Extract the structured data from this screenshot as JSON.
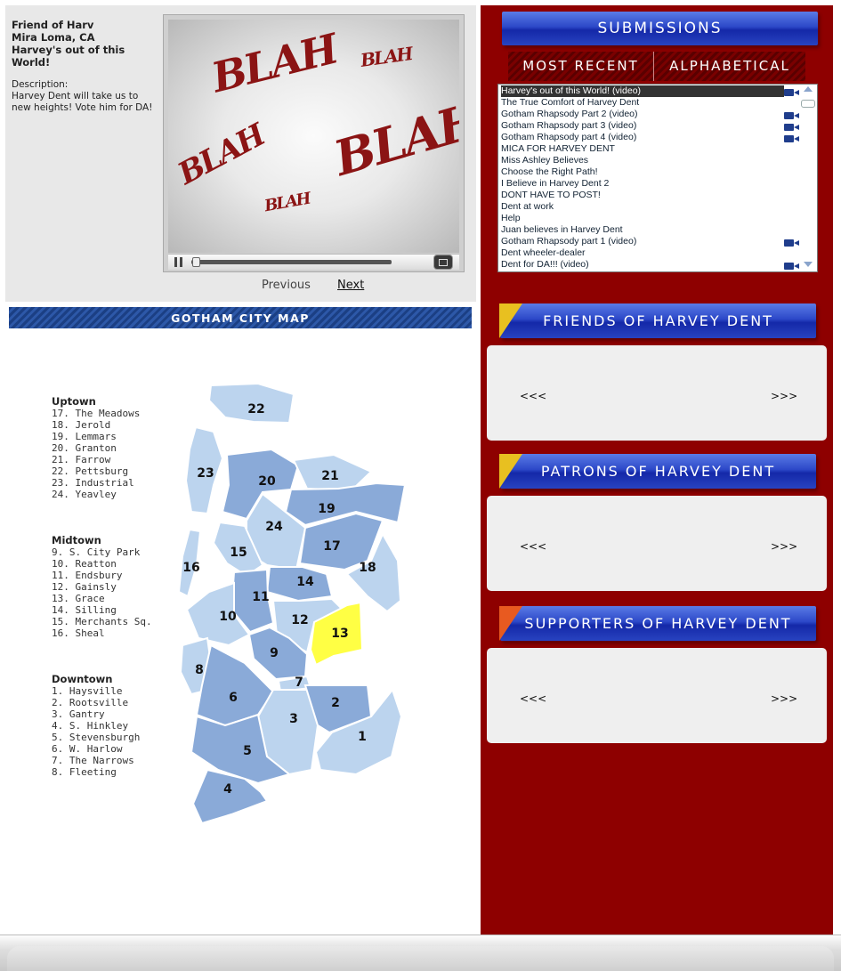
{
  "submission": {
    "author": "Friend of Harv",
    "location": "Mira Loma, CA",
    "title": "Harvey's out of this World!",
    "description_label": "Description:",
    "description": "Harvey Dent will take us to new heights! Vote him for DA!"
  },
  "video": {
    "overlay_words": [
      "BLAH",
      "BLAH",
      "BLAH",
      "BLAH",
      "BLAH",
      "BLAH"
    ],
    "progress": 0.0
  },
  "nav": {
    "previous": "Previous",
    "next": "Next"
  },
  "map": {
    "header": "GOTHAM CITY MAP",
    "highlighted_district": "13",
    "highlight_color": "#ffff44",
    "district_color": "#bcd4ee",
    "district_dark_color": "#8aaad8",
    "legend": [
      {
        "title": "Uptown",
        "items": [
          "17. The Meadows",
          "18. Jerold",
          "19. Lemmars",
          "20. Granton",
          "21. Farrow",
          "22. Pettsburg",
          "23. Industrial",
          "24. Yeavley"
        ]
      },
      {
        "title": "Midtown",
        "items": [
          "9. S. City Park",
          "10. Reatton",
          "11. Endsbury",
          "12. Gainsly",
          "13. Grace",
          "14. Silling",
          "15. Merchants Sq.",
          "16. Sheal"
        ]
      },
      {
        "title": "Downtown",
        "items": [
          "1. Haysville",
          "2. Rootsville",
          "3. Gantry",
          "4. S. Hinkley",
          "5. Stevensburgh",
          "6. W. Harlow",
          "7. The Narrows",
          "8. Fleeting"
        ]
      }
    ],
    "districts": [
      "22",
      "23",
      "20",
      "21",
      "19",
      "24",
      "17",
      "15",
      "16",
      "18",
      "14",
      "11",
      "10",
      "12",
      "13",
      "9",
      "8",
      "7",
      "6",
      "3",
      "2",
      "1",
      "5",
      "4"
    ]
  },
  "submissions": {
    "header": "SUBMISSIONS",
    "tabs": [
      "MOST RECENT",
      "ALPHABETICAL"
    ],
    "items": [
      {
        "label": "Harvey's out of this World! (video)",
        "video": true,
        "selected": true
      },
      {
        "label": "The True Comfort of Harvey Dent",
        "video": false,
        "selected": false
      },
      {
        "label": "Gotham Rhapsody Part 2 (video)",
        "video": true,
        "selected": false
      },
      {
        "label": "Gotham Rhapsody part 3 (video)",
        "video": true,
        "selected": false
      },
      {
        "label": "Gotham Rhapsody part 4 (video)",
        "video": true,
        "selected": false
      },
      {
        "label": "MICA FOR HARVEY DENT",
        "video": false,
        "selected": false
      },
      {
        "label": "Miss Ashley Believes",
        "video": false,
        "selected": false
      },
      {
        "label": "Choose the Right Path!",
        "video": false,
        "selected": false
      },
      {
        "label": "I Believe in Harvey Dent 2",
        "video": false,
        "selected": false
      },
      {
        "label": "DONT HAVE TO POST!",
        "video": false,
        "selected": false
      },
      {
        "label": "Dent at work",
        "video": false,
        "selected": false
      },
      {
        "label": "Help",
        "video": false,
        "selected": false
      },
      {
        "label": "Juan believes in Harvey Dent",
        "video": false,
        "selected": false
      },
      {
        "label": "Gotham Rhapsody part 1 (video)",
        "video": true,
        "selected": false
      },
      {
        "label": "Dent wheeler-dealer",
        "video": false,
        "selected": false
      },
      {
        "label": "Dent for DA!!! (video)",
        "video": true,
        "selected": false
      }
    ]
  },
  "sections": [
    {
      "title": "FRIENDS OF HARVEY DENT",
      "prev": "<<<",
      "next": ">>>",
      "corner_color": "#e8c020"
    },
    {
      "title": "PATRONS OF HARVEY DENT",
      "prev": "<<<",
      "next": ">>>",
      "corner_color": "#e8c020"
    },
    {
      "title": "SUPPORTERS OF HARVEY DENT",
      "prev": "<<<",
      "next": ">>>",
      "corner_color": "#e85a20"
    }
  ],
  "colors": {
    "right_bg": "#8e0000",
    "bar_blue": "#2c48c8",
    "blah_red": "#8b1414"
  }
}
